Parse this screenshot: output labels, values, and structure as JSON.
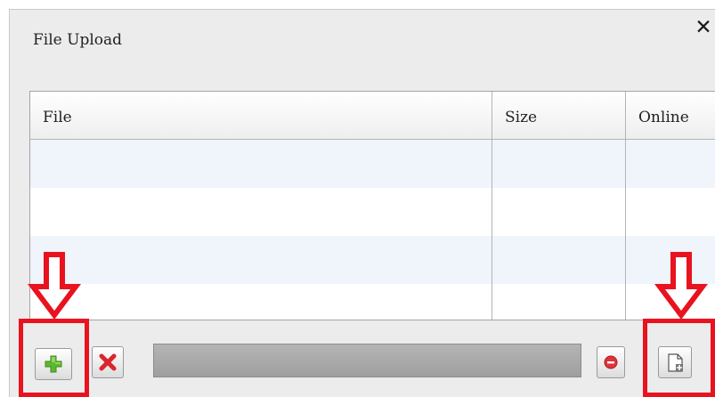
{
  "dialog": {
    "title": "File Upload",
    "close_icon": "close-icon"
  },
  "grid": {
    "columns": [
      "File",
      "Size",
      "Online"
    ],
    "rows": [
      {
        "file": "",
        "size": "",
        "online": ""
      },
      {
        "file": "",
        "size": "",
        "online": ""
      },
      {
        "file": "",
        "size": "",
        "online": ""
      },
      {
        "file": "",
        "size": "",
        "online": ""
      }
    ]
  },
  "toolbar": {
    "add_icon": "plus-icon",
    "remove_icon": "red-x-icon",
    "stop_icon": "minus-circle-icon",
    "upload_icon": "document-plus-icon",
    "progress": 0
  },
  "annotations": {
    "color": "#e8131f",
    "arrow_icon": "down-arrow-icon"
  }
}
